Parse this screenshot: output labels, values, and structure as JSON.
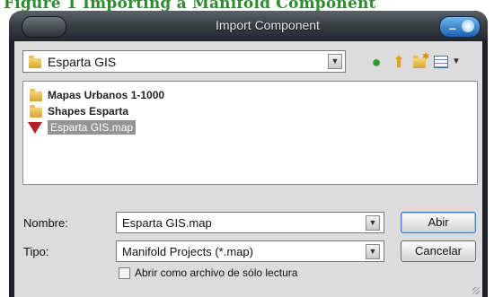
{
  "background_text": "Figure 1 Importing a Manifold Component",
  "dialog": {
    "title": "Import Component",
    "location": "Esparta GIS",
    "files": [
      {
        "name": "Mapas Urbanos 1-1000",
        "type": "folder",
        "selected": false
      },
      {
        "name": "Shapes Esparta",
        "type": "folder",
        "selected": false
      },
      {
        "name": "Esparta GIS.map",
        "type": "map",
        "selected": true
      }
    ],
    "name_label": "Nombre:",
    "name_value": "Esparta GIS.map",
    "type_label": "Tipo:",
    "type_value": "Manifold Projects (*.map)",
    "open_button": "Abir",
    "cancel_button": "Cancelar",
    "readonly_checkbox": "Abrir como archivo de sólo lectura",
    "readonly_checked": false
  },
  "icons": {
    "back": "back-arrow-icon",
    "up": "up-folder-icon",
    "new_folder": "new-folder-icon",
    "views": "view-menu-icon"
  },
  "colors": {
    "title_bar": "#3a3f46",
    "dialog_body": "#dcdcdc",
    "selection": "#949494",
    "accent_blue": "#1b5fb0"
  }
}
